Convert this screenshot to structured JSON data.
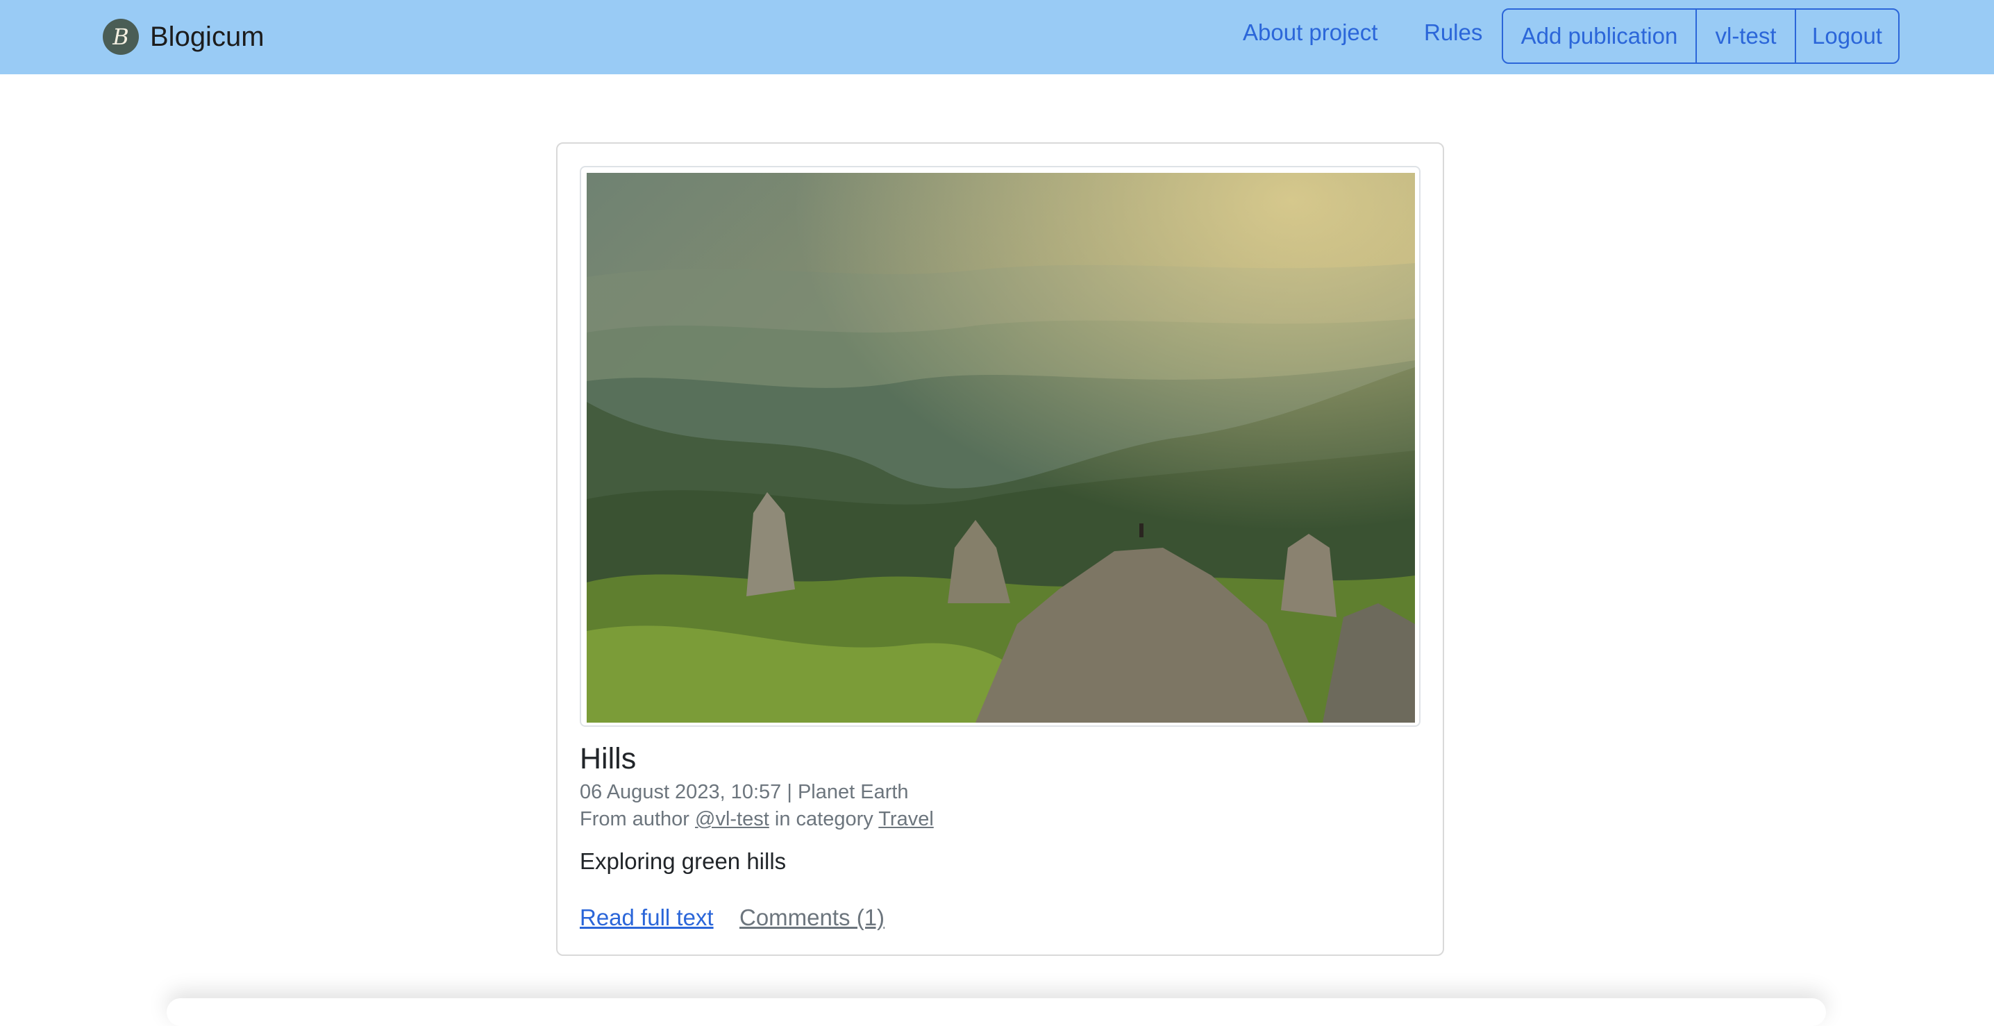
{
  "navbar": {
    "brand_initial": "B",
    "brand_name": "Blogicum",
    "links": {
      "about": "About project",
      "rules": "Rules"
    },
    "buttons": {
      "add_publication": "Add publication",
      "username": "vl-test",
      "logout": "Logout"
    },
    "background_color": "#99cbf5",
    "accent_color": "#2b66d9"
  },
  "post": {
    "title": "Hills",
    "date": "06 August 2023, 10:57",
    "separator": "|",
    "location": "Planet Earth",
    "author_prefix": "From author",
    "author": "@vl-test",
    "category_prefix": "in category",
    "category": "Travel",
    "text": "Exploring green hills",
    "read_link": "Read full text",
    "comments_link": "Comments (1)"
  }
}
